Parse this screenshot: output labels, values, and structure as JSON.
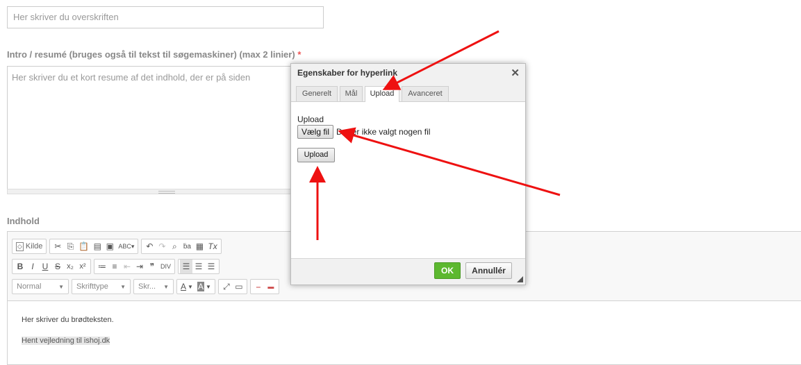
{
  "headline": {
    "placeholder": "Her skriver du overskriften"
  },
  "intro": {
    "label": "Intro / resumé (bruges også til tekst til søgemaskiner) (max 2 linier)",
    "required_mark": "*",
    "placeholder": "Her skriver du et kort resume af det indhold, der er på siden"
  },
  "content": {
    "label": "Indhold",
    "toolbar": {
      "source_label": "Kilde",
      "format_value": "Normal",
      "font_value": "Skrifttype",
      "size_value": "Skr...",
      "text_color_label": "A",
      "bg_color_label": "A"
    },
    "body": {
      "paragraph": "Her skriver du brødteksten.",
      "link_text": "Hent vejledning til ishoj.dk"
    }
  },
  "dialog": {
    "title": "Egenskaber for hyperlink",
    "close": "✕",
    "tabs": [
      "Generelt",
      "Mål",
      "Upload",
      "Avanceret"
    ],
    "active_tab": "Upload",
    "upload_label": "Upload",
    "choose_file_button": "Vælg fil",
    "no_file_text": "Der er ikke valgt nogen fil",
    "upload_button": "Upload",
    "ok_button": "OK",
    "cancel_button": "Annullér"
  },
  "colors": {
    "annotation_arrow": "#ee1111",
    "ok_button": "#5cb82f",
    "required": "#e55555"
  }
}
